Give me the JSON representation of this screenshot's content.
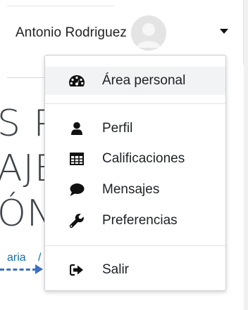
{
  "user": {
    "name": "Antonio Rodriguez"
  },
  "background": {
    "heading_lines": [
      "S PA",
      "AJE",
      "ÓN"
    ],
    "breadcrumb_fragment": "aria",
    "breadcrumb_separator": "/"
  },
  "menu": {
    "items": [
      {
        "label": "Área personal",
        "icon": "dashboard-icon"
      },
      {
        "label": "Perfil",
        "icon": "user-icon"
      },
      {
        "label": "Calificaciones",
        "icon": "table-icon"
      },
      {
        "label": "Mensajes",
        "icon": "comment-icon"
      },
      {
        "label": "Preferencias",
        "icon": "wrench-icon"
      },
      {
        "label": "Salir",
        "icon": "sign-out-icon"
      }
    ]
  },
  "colors": {
    "link": "#0f6cbf",
    "annotation_arrow": "#3a6fc4",
    "active_item_bg": "#f2f3f5"
  }
}
